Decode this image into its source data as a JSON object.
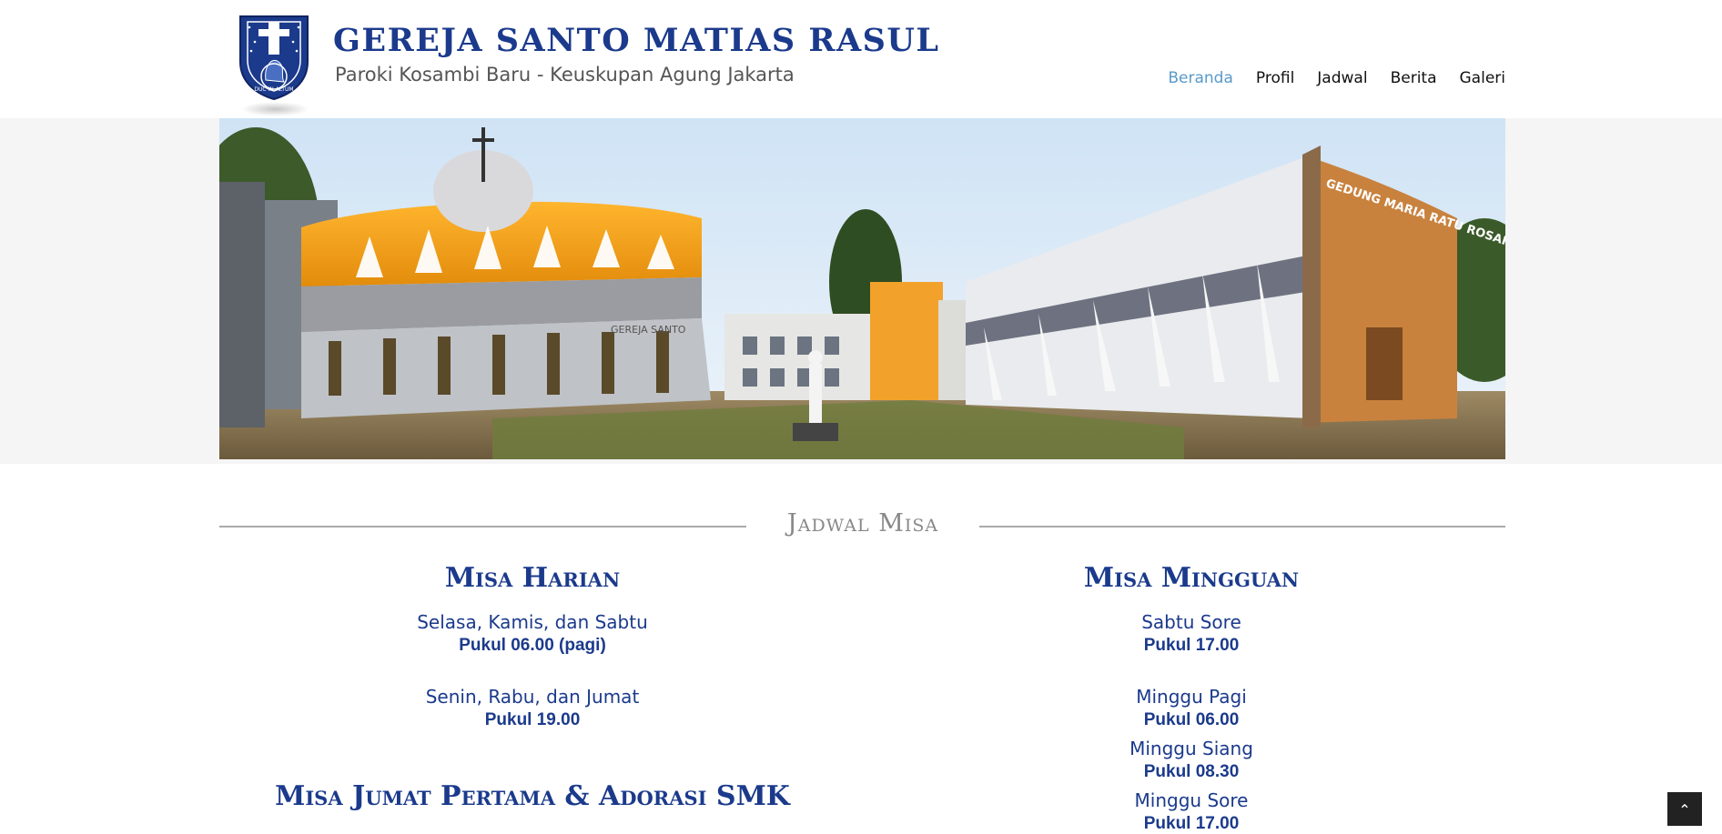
{
  "header": {
    "title": "GEREJA SANTO MATIAS RASUL",
    "subtitle": "Paroki Kosambi Baru - Keuskupan Agung Jakarta",
    "logo_text": "DUC IN ALTUM"
  },
  "nav": {
    "items": [
      {
        "label": "Beranda",
        "active": true
      },
      {
        "label": "Profil",
        "active": false
      },
      {
        "label": "Jadwal",
        "active": false
      },
      {
        "label": "Berita",
        "active": false
      },
      {
        "label": "Galeri",
        "active": false
      }
    ]
  },
  "banner": {
    "building_sign": "GEDUNG MARIA RATU ROSARI",
    "church_sign": "GEREJA SANTO"
  },
  "schedule": {
    "section_title": "Jadwal Misa",
    "harian": {
      "title": "Misa Harian",
      "entries": [
        {
          "day": "Selasa, Kamis, dan Sabtu",
          "time": "Pukul 06.00 (pagi)"
        },
        {
          "day": "Senin, Rabu, dan Jumat",
          "time": "Pukul 19.00"
        }
      ]
    },
    "jumat": {
      "title": "Misa Jumat Pertama & Adorasi SMK"
    },
    "mingguan": {
      "title": "Misa Mingguan",
      "entries": [
        {
          "day": "Sabtu Sore",
          "time": "Pukul 17.00"
        },
        {
          "day": "Minggu Pagi",
          "time": "Pukul 06.00"
        },
        {
          "day": "Minggu Siang",
          "time": "Pukul 08.30"
        },
        {
          "day": "Minggu Sore",
          "time": "Pukul 17.00"
        }
      ]
    }
  },
  "back_to_top_icon": "chevron-up-icon",
  "colors": {
    "brand": "#1b3a8c",
    "nav_active": "#5a9ac9",
    "accent_orange": "#f5a21a"
  }
}
